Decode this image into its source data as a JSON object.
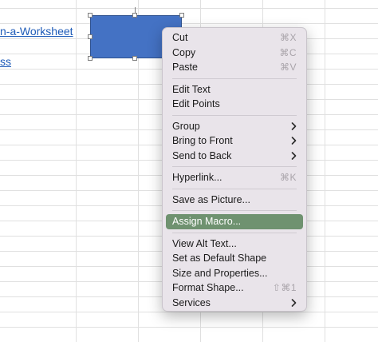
{
  "spreadsheet": {
    "visible_links": [
      "n-a-Worksheet",
      "ss"
    ]
  },
  "menu": {
    "groups": [
      [
        {
          "label": "Cut",
          "shortcut": "⌘X"
        },
        {
          "label": "Copy",
          "shortcut": "⌘C"
        },
        {
          "label": "Paste",
          "shortcut": "⌘V"
        }
      ],
      [
        {
          "label": "Edit Text"
        },
        {
          "label": "Edit Points"
        }
      ],
      [
        {
          "label": "Group",
          "submenu": true
        },
        {
          "label": "Bring to Front",
          "submenu": true
        },
        {
          "label": "Send to Back",
          "submenu": true
        }
      ],
      [
        {
          "label": "Hyperlink...",
          "shortcut": "⌘K"
        }
      ],
      [
        {
          "label": "Save as Picture..."
        }
      ],
      [
        {
          "label": "Assign Macro...",
          "highlighted": true
        }
      ],
      [
        {
          "label": "View Alt Text..."
        },
        {
          "label": "Set as Default Shape"
        },
        {
          "label": "Size and Properties..."
        },
        {
          "label": "Format Shape...",
          "shortcut": "⇧⌘1"
        },
        {
          "label": "Services",
          "submenu": true
        }
      ]
    ]
  },
  "colors": {
    "shape_fill": "#4472c4",
    "menu_highlight": "#6f9270",
    "link": "#1e5bb8"
  }
}
